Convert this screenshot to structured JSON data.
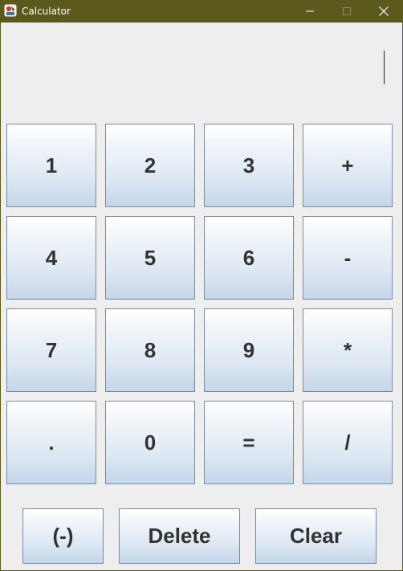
{
  "window": {
    "title": "Calculator",
    "titlebar_color": "#5b5a1c",
    "icons": {
      "app": "calculator-app-icon",
      "minimize": "minimize-icon",
      "maximize": "maximize-icon",
      "close": "close-icon"
    }
  },
  "display": {
    "value": ""
  },
  "keypad": {
    "rows": [
      [
        "1",
        "2",
        "3",
        "+"
      ],
      [
        "4",
        "5",
        "6",
        "-"
      ],
      [
        "7",
        "8",
        "9",
        "*"
      ],
      [
        ".",
        "0",
        "=",
        "/"
      ]
    ]
  },
  "bottom": {
    "negate": "(-)",
    "delete": "Delete",
    "clear": "Clear"
  }
}
